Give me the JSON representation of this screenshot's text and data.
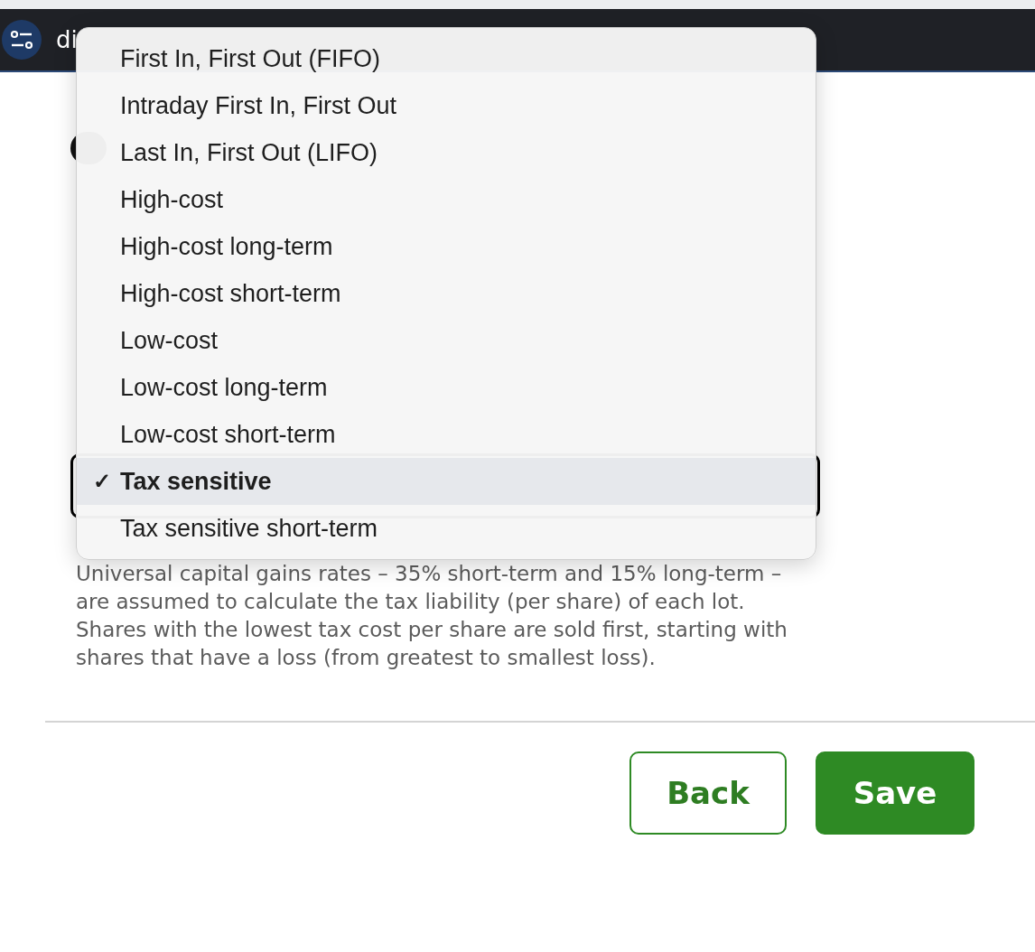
{
  "top_bar": {
    "title": "di"
  },
  "menu": {
    "items": [
      {
        "label": "First In, First Out (FIFO)",
        "selected": false
      },
      {
        "label": "Intraday First In, First Out",
        "selected": false
      },
      {
        "label": "Last In, First Out (LIFO)",
        "selected": false
      },
      {
        "label": "High-cost",
        "selected": false
      },
      {
        "label": "High-cost long-term",
        "selected": false
      },
      {
        "label": "High-cost short-term",
        "selected": false
      },
      {
        "label": "Low-cost",
        "selected": false
      },
      {
        "label": "Low-cost long-term",
        "selected": false
      },
      {
        "label": "Low-cost short-term",
        "selected": false
      },
      {
        "label": "Tax sensitive",
        "selected": true
      },
      {
        "label": "Tax sensitive short-term",
        "selected": false
      }
    ],
    "check": "✓"
  },
  "description": "Universal capital gains rates – 35% short-term and 15% long-term – are assumed to calculate the tax liability (per share) of each lot. Shares with the lowest tax cost per share are sold first, starting with shares that have a loss (from greatest to smallest loss).",
  "buttons": [
    {
      "label": "Back",
      "kind": "secondary"
    },
    {
      "label": "Save",
      "kind": "primary"
    }
  ]
}
